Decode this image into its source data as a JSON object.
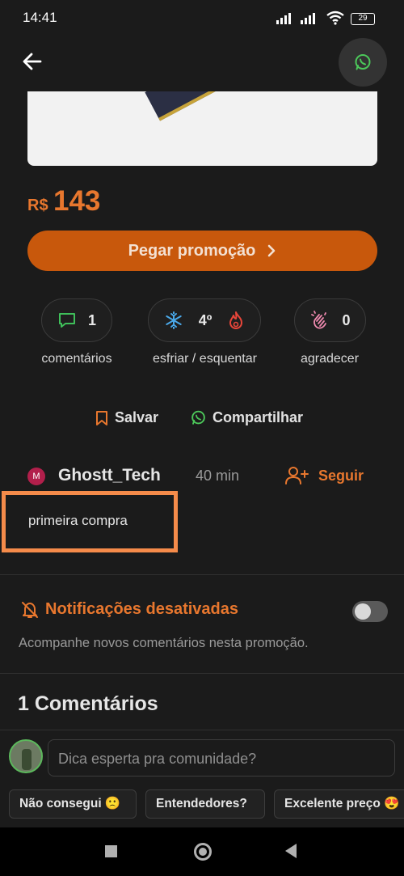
{
  "status_bar": {
    "time": "14:41",
    "battery": "29"
  },
  "deal": {
    "currency": "R$",
    "price": "143",
    "cta_label": "Pegar promoção"
  },
  "stats": {
    "comments_count": "1",
    "comments_label": "comentários",
    "temperature": "4º",
    "temperature_label": "esfriar / esquentar",
    "thanks_count": "0",
    "thanks_label": "agradecer"
  },
  "actions": {
    "save_label": "Salvar",
    "share_label": "Compartilhar"
  },
  "author": {
    "initial": "M",
    "name": "Ghostt_Tech",
    "time": "40 min",
    "follow_label": "Seguir"
  },
  "description": "primeira compra",
  "notifications": {
    "title": "Notificações desativadas",
    "subtitle": "Acompanhe novos comentários nesta promoção.",
    "enabled": false
  },
  "comments": {
    "title": "1 Comentários"
  },
  "composer": {
    "placeholder": "Dica esperta pra comunidade?"
  },
  "quick_replies": [
    "Não consegui 🙁",
    "Entendedores?",
    "Excelente preço 😍"
  ],
  "colors": {
    "accent": "#e8772e",
    "cta": "#c8580c",
    "background": "#1b1b1b",
    "highlight_box": "#f58b4a"
  },
  "icons": [
    "back-arrow-icon",
    "whatsapp-icon",
    "comment-icon",
    "snowflake-icon",
    "flame-icon",
    "clap-icon",
    "bookmark-icon",
    "add-user-icon",
    "bell-off-icon",
    "chevron-right-icon"
  ]
}
